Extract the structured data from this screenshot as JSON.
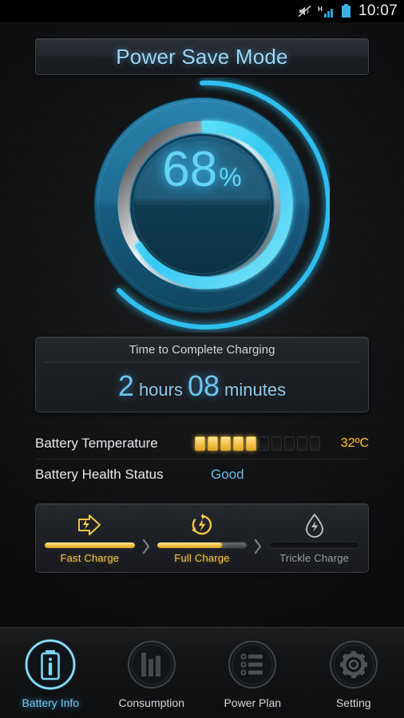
{
  "statusbar": {
    "icons": [
      "mute-icon",
      "signal-h-icon",
      "battery-icon"
    ],
    "clock": "10:07"
  },
  "header": {
    "title": "Power Save Mode"
  },
  "gauge": {
    "value": "68",
    "percent_symbol": "%",
    "value_number": 68,
    "accent_color": "#36c8f0",
    "ring_dark_color": "#0d4a63"
  },
  "charging": {
    "title": "Time to Complete Charging",
    "hours_value": "2",
    "hours_unit": "hours",
    "minutes_value": "08",
    "minutes_unit": "minutes"
  },
  "info_rows": [
    {
      "label": "Battery Temperature",
      "value": "32ºC",
      "segments_total": 10,
      "segments_filled": 5,
      "value_color": "#f0bc3c"
    },
    {
      "label": "Battery Health Status",
      "value": "Good",
      "value_color": "#6fb9e6"
    }
  ],
  "stages": [
    {
      "label": "Fast Charge",
      "icon": "fast-charge-arrow-bolt-icon",
      "fill_percent": 100,
      "state": "complete",
      "color": "#f0c54a"
    },
    {
      "label": "Full Charge",
      "icon": "full-charge-refresh-bolt-icon",
      "fill_percent": 72,
      "state": "active",
      "color": "#f0c54a"
    },
    {
      "label": "Trickle Charge",
      "icon": "trickle-charge-droplet-bolt-icon",
      "fill_percent": 0,
      "state": "inactive",
      "color": "#9aa0a6"
    }
  ],
  "nav": [
    {
      "label": "Battery Info",
      "icon": "battery-info-icon",
      "active": true
    },
    {
      "label": "Consumption",
      "icon": "bar-chart-icon",
      "active": false
    },
    {
      "label": "Power Plan",
      "icon": "list-icon",
      "active": false
    },
    {
      "label": "Setting",
      "icon": "gear-icon",
      "active": false
    }
  ]
}
